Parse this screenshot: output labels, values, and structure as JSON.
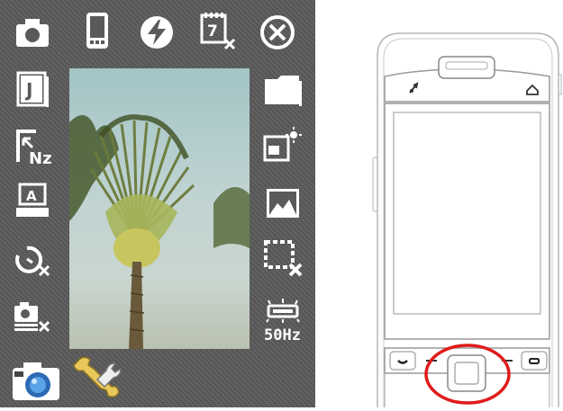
{
  "camera_ui": {
    "left_toolbar": [
      {
        "icon": "camera-mode-icon"
      },
      {
        "icon": "jpeg-format-icon"
      },
      {
        "icon": "resolution-icon"
      },
      {
        "icon": "scene-auto-icon"
      },
      {
        "icon": "self-timer-off-icon"
      },
      {
        "icon": "burst-off-icon"
      }
    ],
    "top_toolbar": [
      {
        "icon": "phone-device-icon"
      },
      {
        "icon": "flash-icon"
      },
      {
        "icon": "date-stamp-off-icon"
      },
      {
        "icon": "close-icon"
      }
    ],
    "right_toolbar": [
      {
        "icon": "folder-icon"
      },
      {
        "icon": "brightness-icon"
      },
      {
        "icon": "image-quality-icon"
      },
      {
        "icon": "frame-off-icon"
      },
      {
        "icon": "flicker-icon",
        "label": "50Hz"
      }
    ],
    "bottom_toolbar": [
      {
        "icon": "camera-shutter-icon"
      },
      {
        "icon": "settings-wrench-icon"
      }
    ]
  },
  "phone_diagram": {
    "top_bar_icons": [
      "signal-icon",
      "home-icon"
    ],
    "bottom_buttons": [
      "left-softkey",
      "left-dash",
      "center-dpad",
      "right-dash",
      "right-softkey"
    ],
    "highlight_color": "#e01b1b"
  }
}
